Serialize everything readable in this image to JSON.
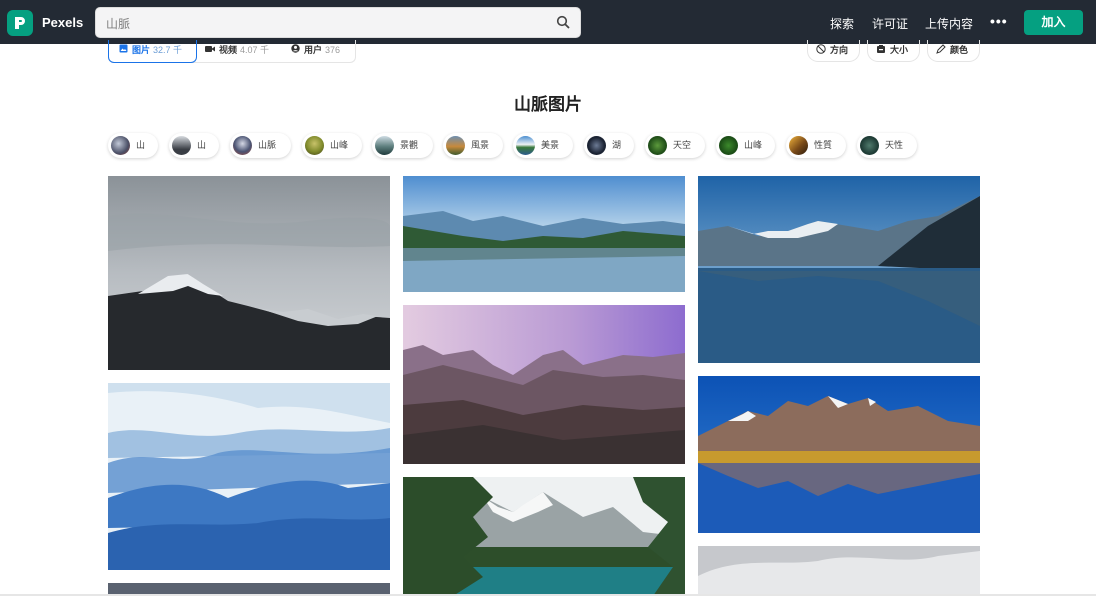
{
  "header": {
    "brand": "Pexels",
    "search_value": "山脈",
    "nav": [
      "探索",
      "许可证",
      "上传内容"
    ],
    "more": "•••",
    "join": "加入"
  },
  "tabs": [
    {
      "label": "图片",
      "count": "32.7 千",
      "icon": "image-icon"
    },
    {
      "label": "视频",
      "count": "4.07 千",
      "icon": "video-icon"
    },
    {
      "label": "用户",
      "count": "376",
      "icon": "user-icon"
    }
  ],
  "filters": [
    {
      "label": "方向",
      "icon": "orientation-icon"
    },
    {
      "label": "大小",
      "icon": "size-icon"
    },
    {
      "label": "颜色",
      "icon": "color-pencil-icon"
    }
  ],
  "page_title": "山脈图片",
  "chips": [
    {
      "label": "山"
    },
    {
      "label": "山"
    },
    {
      "label": "山脈"
    },
    {
      "label": "山峰"
    },
    {
      "label": "景觀"
    },
    {
      "label": "風景"
    },
    {
      "label": "美景"
    },
    {
      "label": "湖"
    },
    {
      "label": "天空"
    },
    {
      "label": "山峰"
    },
    {
      "label": "性質"
    },
    {
      "label": "天性"
    }
  ],
  "colors": {
    "brand": "#05a081",
    "topbar": "#232a34",
    "active_tab": "#1a73e8"
  }
}
